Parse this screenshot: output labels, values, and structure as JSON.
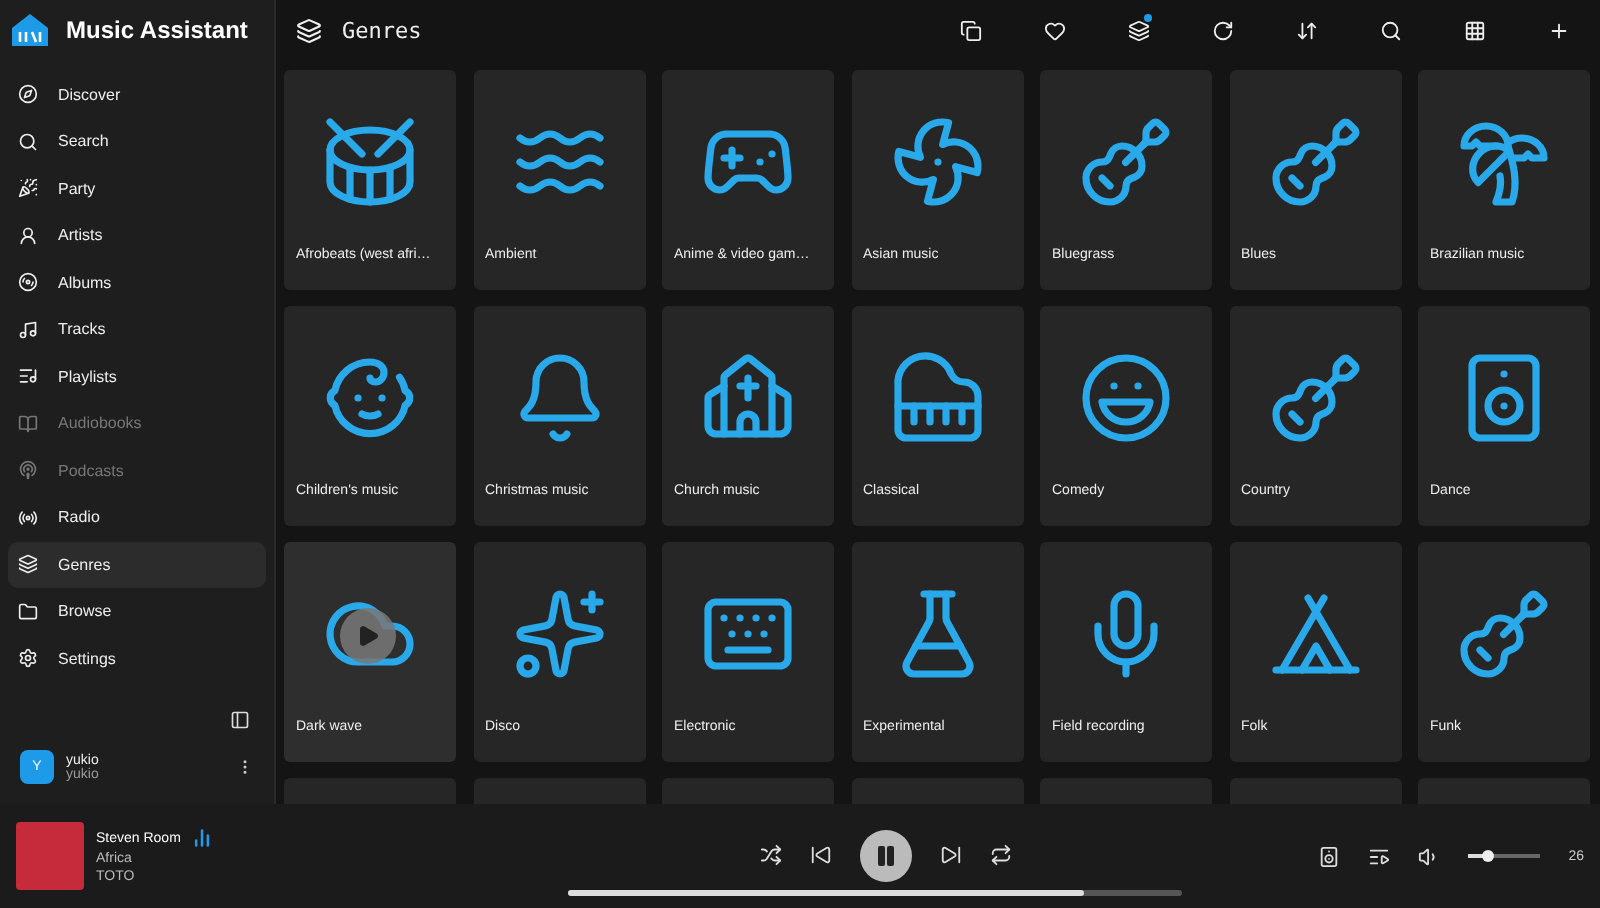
{
  "app": {
    "title": "Music Assistant"
  },
  "sidebar": {
    "items": [
      {
        "label": "Discover",
        "selected": false,
        "disabled": false
      },
      {
        "label": "Search",
        "selected": false,
        "disabled": false
      },
      {
        "label": "Party",
        "selected": false,
        "disabled": false
      },
      {
        "label": "Artists",
        "selected": false,
        "disabled": false
      },
      {
        "label": "Albums",
        "selected": false,
        "disabled": false
      },
      {
        "label": "Tracks",
        "selected": false,
        "disabled": false
      },
      {
        "label": "Playlists",
        "selected": false,
        "disabled": false
      },
      {
        "label": "Audiobooks",
        "selected": false,
        "disabled": true
      },
      {
        "label": "Podcasts",
        "selected": false,
        "disabled": true
      },
      {
        "label": "Radio",
        "selected": false,
        "disabled": false
      },
      {
        "label": "Genres",
        "selected": true,
        "disabled": false
      },
      {
        "label": "Browse",
        "selected": false,
        "disabled": false
      },
      {
        "label": "Settings",
        "selected": false,
        "disabled": false
      }
    ],
    "user": {
      "initial": "Y",
      "name": "yukio",
      "username": "yukio"
    }
  },
  "header": {
    "title": "Genres",
    "actions": [
      {
        "badge": false
      },
      {
        "badge": false
      },
      {
        "badge": true
      },
      {
        "badge": false
      },
      {
        "badge": false
      },
      {
        "badge": false
      },
      {
        "badge": false
      },
      {
        "badge": false
      }
    ]
  },
  "genres": [
    {
      "label": "Afrobeats (west afri…",
      "hovered": false
    },
    {
      "label": "Ambient",
      "hovered": false
    },
    {
      "label": "Anime & video gam…",
      "hovered": false
    },
    {
      "label": "Asian music",
      "hovered": false
    },
    {
      "label": "Bluegrass",
      "hovered": false
    },
    {
      "label": "Blues",
      "hovered": false
    },
    {
      "label": "Brazilian music",
      "hovered": false
    },
    {
      "label": "Children's music",
      "hovered": false
    },
    {
      "label": "Christmas music",
      "hovered": false
    },
    {
      "label": "Church music",
      "hovered": false
    },
    {
      "label": "Classical",
      "hovered": false
    },
    {
      "label": "Comedy",
      "hovered": false
    },
    {
      "label": "Country",
      "hovered": false
    },
    {
      "label": "Dance",
      "hovered": false
    },
    {
      "label": "Dark wave",
      "hovered": true
    },
    {
      "label": "Disco",
      "hovered": false
    },
    {
      "label": "Electronic",
      "hovered": false
    },
    {
      "label": "Experimental",
      "hovered": false
    },
    {
      "label": "Field recording",
      "hovered": false
    },
    {
      "label": "Folk",
      "hovered": false
    },
    {
      "label": "Funk",
      "hovered": false
    }
  ],
  "player": {
    "player_name": "Steven Room",
    "track": "Africa",
    "artist": "TOTO",
    "playing": true,
    "progress": {
      "level": 0.84
    },
    "volume": {
      "level": 0.26,
      "reading": "26"
    }
  }
}
